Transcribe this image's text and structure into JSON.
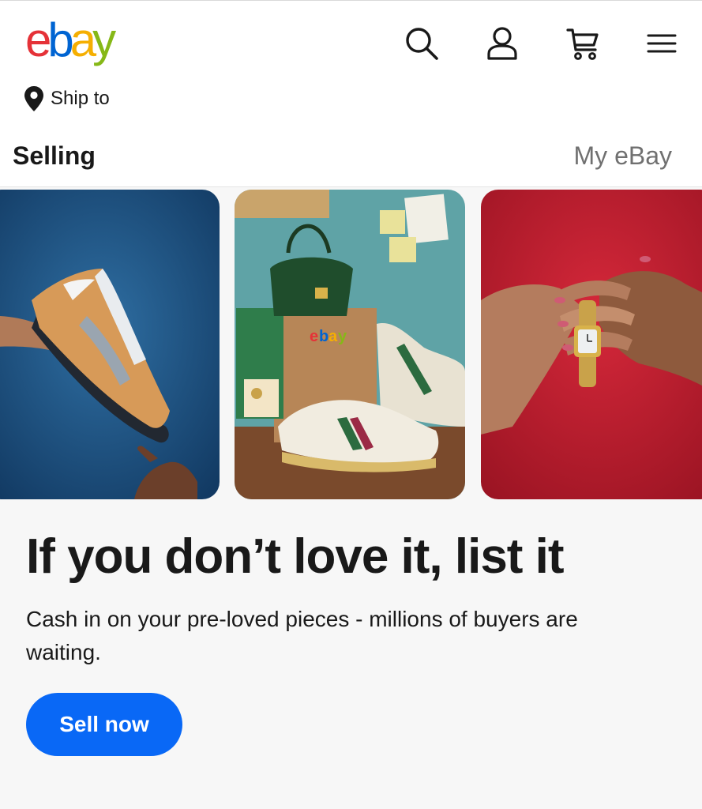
{
  "header": {
    "logo_letters": [
      "e",
      "b",
      "a",
      "y"
    ],
    "icons": {
      "search": "search-icon",
      "account": "person-icon",
      "cart": "cart-icon",
      "menu": "hamburger-menu-icon"
    },
    "ship_to_label": "Ship to"
  },
  "tabs": {
    "selling": "Selling",
    "my_ebay": "My eBay"
  },
  "hero": {
    "tiles": [
      {
        "subject": "sneaker"
      },
      {
        "subject": "handbag-and-sneakers",
        "box_text": "ebay"
      },
      {
        "subject": "watch-on-hands"
      }
    ],
    "headline": "If you don’t love it, list it",
    "subtext": "Cash in on your pre-loved pieces - millions of buyers are waiting.",
    "cta_label": "Sell now"
  },
  "colors": {
    "logo_e": "#e53238",
    "logo_b": "#0064d2",
    "logo_a": "#f5af02",
    "logo_y": "#86b817",
    "cta": "#0968f6",
    "tab_muted": "#707070"
  }
}
